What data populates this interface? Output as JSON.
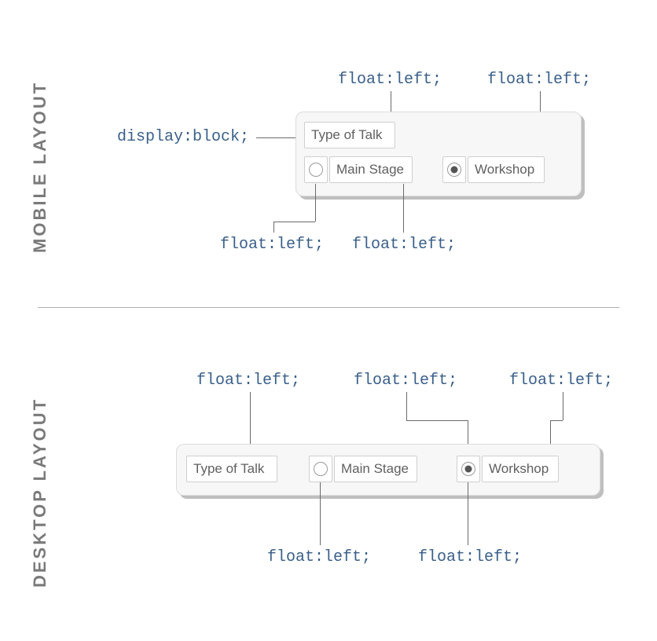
{
  "sections": {
    "mobile": {
      "label": "MOBILE LAYOUT"
    },
    "desktop": {
      "label": "DESKTOP LAYOUT"
    }
  },
  "annotations": {
    "float_left": "float:left;",
    "display_block": "display:block;"
  },
  "form": {
    "title": "Type of Talk",
    "option_a": "Main Stage",
    "option_b": "Workshop"
  }
}
